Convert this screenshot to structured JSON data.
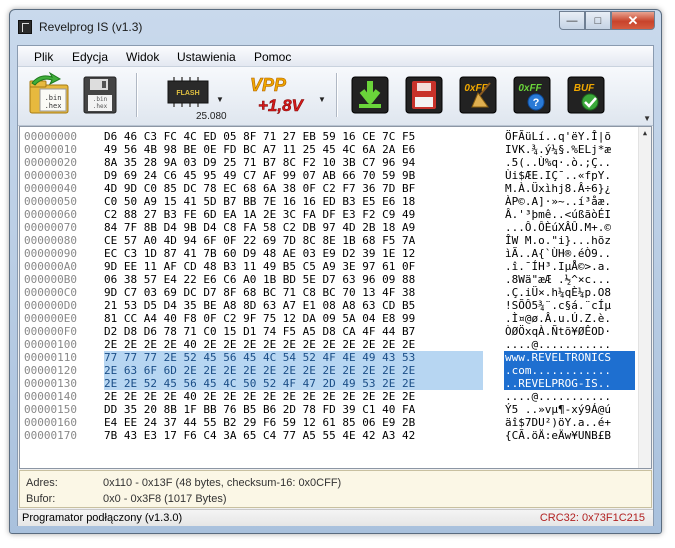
{
  "window": {
    "title": "Revelprog IS (v1.3)",
    "caption_buttons": [
      "minimize",
      "maximize",
      "close"
    ]
  },
  "menu": [
    "Plik",
    "Edycja",
    "Widok",
    "Ustawienia",
    "Pomoc"
  ],
  "toolbar": {
    "open_icon_caption": ".bin\n.hex",
    "flash_chip_label": "FLASH",
    "flash_chip_code": "25.080",
    "vpp_title": "VPP",
    "vpp_voltage": "+1,8V",
    "button_labels": [
      "0xFF",
      "0xFF",
      "BUF"
    ]
  },
  "hex": {
    "rows": [
      {
        "addr": "00000000",
        "bytes": "D6 46 C3 FC 4C ED 05 8F 71 27 EB 59 16 CE 7C F5",
        "ascii": "ÖFÃüLí..q'ëY.Î|õ"
      },
      {
        "addr": "00000010",
        "bytes": "49 56 4B 98 BE 0E FD BC A7 11 25 45 4C 6A 2A E6",
        "ascii": "IVK.¾.ý¼§.%ELj*æ"
      },
      {
        "addr": "00000020",
        "bytes": "8A 35 28 9A 03 D9 25 71 B7 8C F2 10 3B C7 96 94",
        "ascii": ".5(..Ù%q·.ò.;Ç.."
      },
      {
        "addr": "00000030",
        "bytes": "D9 69 24 C6 45 95 49 C7 AF 99 07 AB 66 70 59 9B",
        "ascii": "Ùi$ÆE.IÇ¯..«fpY."
      },
      {
        "addr": "00000040",
        "bytes": "4D 9D C0 85 DC 78 EC 68 6A 38 0F C2 F7 36 7D BF",
        "ascii": "M.À.Üxìhj8.Â÷6}¿"
      },
      {
        "addr": "00000050",
        "bytes": "C0 50 A9 15 41 5D B7 BB 7E 16 16 ED B3 E5 E6 18",
        "ascii": "ÀP©.A]·»~..í³åæ."
      },
      {
        "addr": "00000060",
        "bytes": "C2 88 27 B3 FE 6D EA 1A 2E 3C FA DF E3 F2 C9 49",
        "ascii": "Â.'³þmê..<úßãòÉI"
      },
      {
        "addr": "00000070",
        "bytes": "84 7F 8B D4 9B D4 C8 FA 58 C2 DB 97 4D 2B 18 A9",
        "ascii": "...Ô.ÔÈúXÂÛ.M+.©"
      },
      {
        "addr": "00000080",
        "bytes": "CE 57 A0 4D 94 6F 0F 22 69 7D 8C 8E 1B 68 F5 7A",
        "ascii": "ÎW M.o.\"i}...hõz"
      },
      {
        "addr": "00000090",
        "bytes": "EC C3 1D 87 41 7B 60 D9 48 AE 03 E9 D2 39 1E 12",
        "ascii": "ìÃ..A{`ÙH®.éÒ9.."
      },
      {
        "addr": "000000A0",
        "bytes": "9D EE 11 AF CD 48 B3 11 49 B5 C5 A9 3E 97 61 0F",
        "ascii": ".î.¯ÍH³.IµÅ©>.a."
      },
      {
        "addr": "000000B0",
        "bytes": "06 38 57 E4 22 E6 C6 A0 1B BD 5E D7 63 96 09 88",
        "ascii": ".8Wä\"æÆ .½^×c..."
      },
      {
        "addr": "000000C0",
        "bytes": "9D C7 03 69 DC D7 8F 68 BC 71 C8 BC 70 13 4F 38",
        "ascii": ".Ç.iÜ×.h¼qÈ¼p.O8"
      },
      {
        "addr": "000000D0",
        "bytes": "21 53 D5 D4 35 BE A8 8D 63 A7 E1 08 A8 63 CD B5",
        "ascii": "!SÕÔ5¾¨.c§á.¨cÍµ"
      },
      {
        "addr": "000000E0",
        "bytes": "81 CC A4 40 F8 0F C2 9F 75 12 DA 09 5A 04 E8 99",
        "ascii": ".Ì¤@ø.Â.u.Ú.Z.è."
      },
      {
        "addr": "000000F0",
        "bytes": "D2 D8 D6 78 71 C0 15 D1 74 F5 A5 D8 CA 4F 44 B7",
        "ascii": "ÒØÖxqÀ.Ñtõ¥ØÊOD·"
      },
      {
        "addr": "00000100",
        "bytes": "2E 2E 2E 2E 40 2E 2E 2E 2E 2E 2E 2E 2E 2E 2E 2E",
        "ascii": "....@..........."
      },
      {
        "addr": "00000110",
        "bytes": "77 77 77 2E 52 45 56 45 4C 54 52 4F 4E 49 43 53",
        "ascii": "www.REVELTRONICS",
        "selected": true
      },
      {
        "addr": "00000120",
        "bytes": "2E 63 6F 6D 2E 2E 2E 2E 2E 2E 2E 2E 2E 2E 2E 2E",
        "ascii": ".com............",
        "selected": true
      },
      {
        "addr": "00000130",
        "bytes": "2E 2E 52 45 56 45 4C 50 52 4F 47 2D 49 53 2E 2E",
        "ascii": "..REVELPROG-IS..",
        "selected": true
      },
      {
        "addr": "00000140",
        "bytes": "2E 2E 2E 2E 40 2E 2E 2E 2E 2E 2E 2E 2E 2E 2E 2E",
        "ascii": "....@..........."
      },
      {
        "addr": "00000150",
        "bytes": "DD 35 20 8B 1F BB 76 B5 B6 2D 78 FD 39 C1 40 FA",
        "ascii": "Ý5 ..»vµ¶-xý9Á@ú"
      },
      {
        "addr": "00000160",
        "bytes": "E4 EE 24 37 44 55 B2 29 F6 59 12 61 85 06 E9 2B",
        "ascii": "äî$7DU²)öY.a..é+"
      },
      {
        "addr": "00000170",
        "bytes": "7B 43 E3 17 F6 C4 3A 65 C4 77 A5 55 4E 42 A3 42",
        "ascii": "{CÃ.öÄ:eÄw¥UNB£B"
      }
    ]
  },
  "info": {
    "adres_label": "Adres:",
    "adres_value": "0x110 - 0x13F (48 bytes, checksum-16: 0x0CFF)",
    "bufor_label": "Bufor:",
    "bufor_value": "0x0 - 0x3F8 (1017 Bytes)"
  },
  "status": {
    "left": "Programator podłączony (v1.3.0)",
    "crc": "CRC32: 0x73F1C215"
  },
  "colors": {
    "selection_hex_bg": "#b7d6f2",
    "selection_ascii_bg": "#1e6fd0",
    "crc_text": "#b22222",
    "address_text": "#888888"
  }
}
